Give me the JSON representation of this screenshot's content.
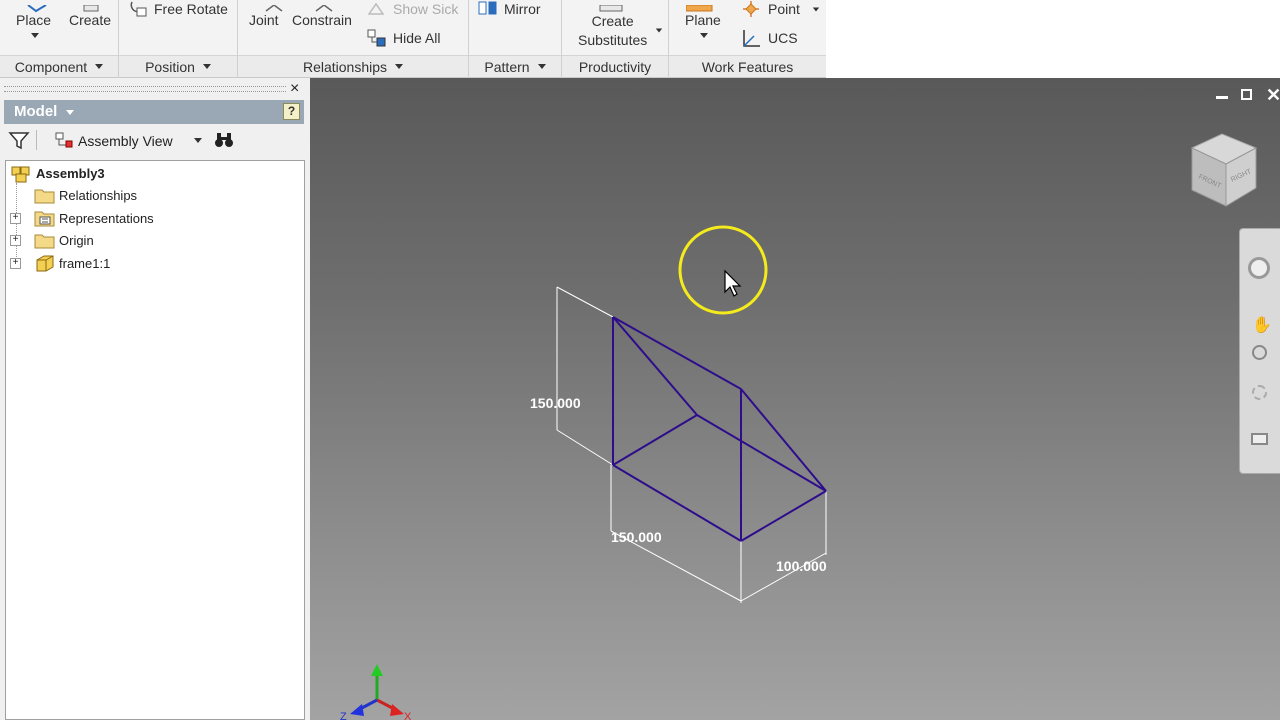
{
  "ribbon": {
    "component": {
      "place": "Place",
      "create": "Create",
      "group": "Component"
    },
    "position": {
      "free_rotate": "Free Rotate",
      "group": "Position"
    },
    "relationships": {
      "joint": "Joint",
      "constrain": "Constrain",
      "show_sick": "Show Sick",
      "hide_all": "Hide All",
      "group": "Relationships"
    },
    "pattern": {
      "mirror": "Mirror",
      "group": "Pattern"
    },
    "productivity": {
      "create_line1": "Create",
      "create_line2": "Substitutes",
      "group": "Productivity"
    },
    "work_features": {
      "plane": "Plane",
      "point": "Point",
      "ucs": "UCS",
      "group": "Work Features"
    }
  },
  "panel": {
    "title": "Model",
    "view_selector": "Assembly View",
    "help": "?",
    "close": "×"
  },
  "tree": [
    {
      "label": "Assembly3",
      "bold": true,
      "icon": "assembly-icon",
      "expander": false
    },
    {
      "label": "Relationships",
      "bold": false,
      "icon": "folder-icon",
      "expander": false
    },
    {
      "label": "Representations",
      "bold": false,
      "icon": "representations-icon",
      "expander": true
    },
    {
      "label": "Origin",
      "bold": false,
      "icon": "folder-icon",
      "expander": true
    },
    {
      "label": "frame1:1",
      "bold": false,
      "icon": "part-icon",
      "expander": true
    }
  ],
  "viewport": {
    "dimensions": {
      "height": "150.000",
      "length": "150.000",
      "width": "100.000"
    },
    "viewcube": {
      "face1": "FRONT",
      "face2": "RIGHT"
    },
    "axes": {
      "x": "X",
      "z": "Z"
    }
  },
  "colors": {
    "frame": "#2e0d8c",
    "cursor_ring": "#f4ea1c",
    "panel_header": "#9aa7b4"
  }
}
